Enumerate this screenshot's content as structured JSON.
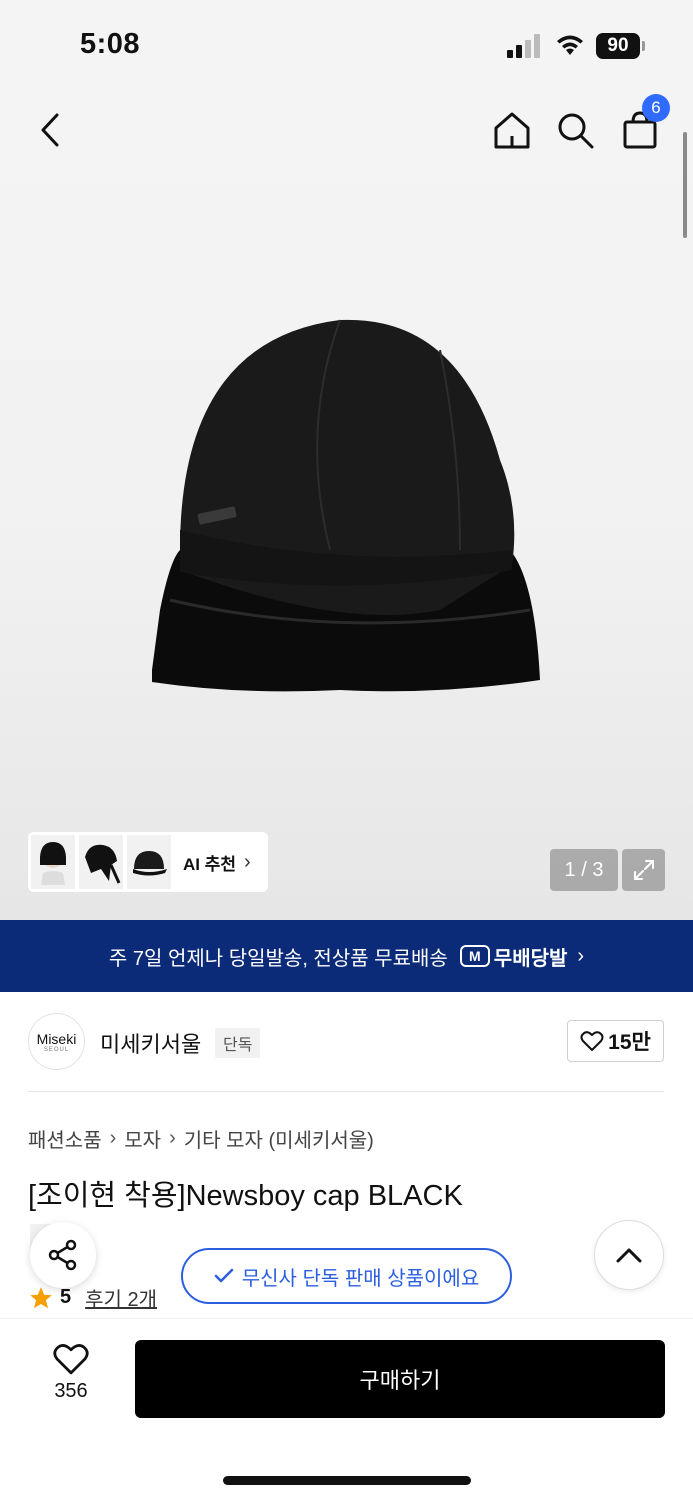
{
  "status_bar": {
    "time": "5:08",
    "battery": "90"
  },
  "nav": {
    "cart_count": "6"
  },
  "gallery": {
    "ai_label": "AI 추천",
    "page_indicator": "1 / 3"
  },
  "banner": {
    "text": "주 7일 언제나 당일발송, 전상품 무료배송",
    "logo_mark": "M",
    "logo_text": "무배당발"
  },
  "brand": {
    "logo_text": "Miseki",
    "logo_subtext": "SEOUL",
    "name": "미세키서울",
    "tag": "단독",
    "likes": "15만"
  },
  "breadcrumb": [
    "패션소품",
    "모자",
    "기타 모자 (미세키서울)"
  ],
  "product": {
    "title": "[조이현 착용]Newsboy cap BLACK",
    "tag": "단독",
    "rating": "5",
    "reviews": "후기 2개"
  },
  "exclusive_notice": "무신사 단독 판매 상품이에요",
  "bottom_bar": {
    "wishlist_count": "356",
    "buy_label": "구매하기"
  },
  "colors": {
    "banner_bg": "#0b2a78",
    "accent_blue": "#2b5fe0",
    "badge_blue": "#2f6bff",
    "star": "#f5a000"
  }
}
